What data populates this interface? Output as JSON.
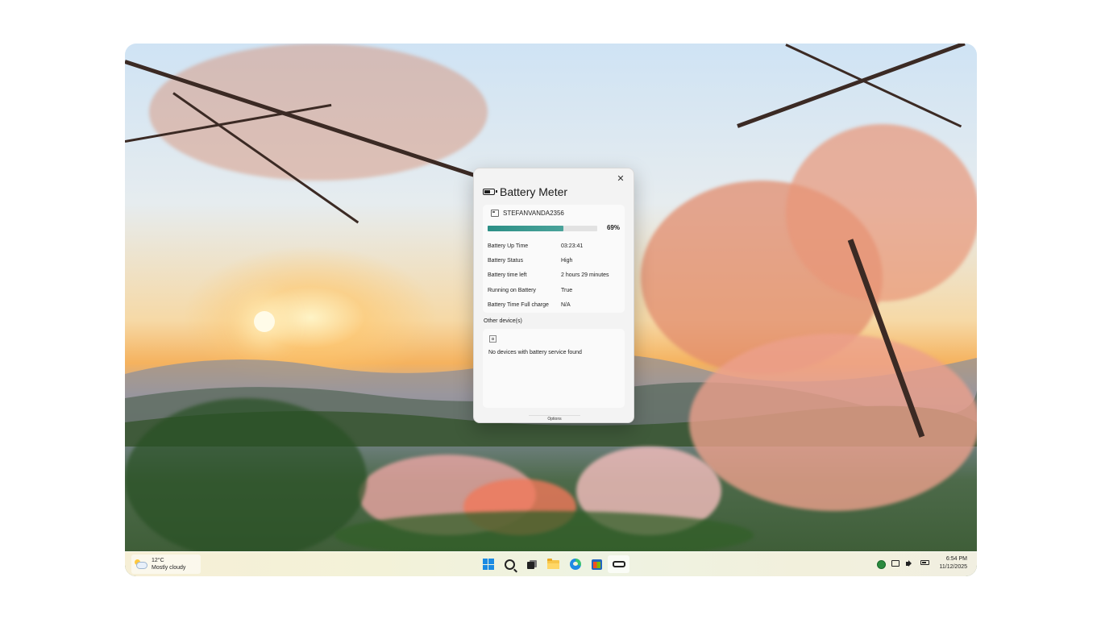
{
  "window": {
    "title": "Battery Meter",
    "close_glyph": "✕",
    "device_name": "STEFANVANDA2356",
    "battery_percent_label": "69%",
    "battery_level": 0.69,
    "details": [
      {
        "label": "Battery Up Time",
        "value": "03:23:41"
      },
      {
        "label": "Battery Status",
        "value": "High"
      },
      {
        "label": "Battery time left",
        "value": "2 hours 29 minutes"
      },
      {
        "label": "Running on Battery",
        "value": "True"
      },
      {
        "label": "Battery Time Full charge",
        "value": "N/A"
      }
    ],
    "other_devices_label": "Other device(s)",
    "no_devices_text": "No devices with battery service found",
    "options_label": "Options"
  },
  "taskbar": {
    "weather_temp": "12°C",
    "weather_desc": "Mostly cloudy",
    "apps": [
      "start-icon",
      "search-icon",
      "task-view-icon",
      "file-explorer-icon",
      "edge-icon",
      "store-icon",
      "battery-meter-icon"
    ],
    "tray": [
      "security-icon",
      "network-icon",
      "volume-icon",
      "battery-icon"
    ],
    "time": "6:54 PM",
    "date": "11/12/2025"
  },
  "colors": {
    "accent": "#2c8f86",
    "win_blue": "#1b8be3"
  }
}
